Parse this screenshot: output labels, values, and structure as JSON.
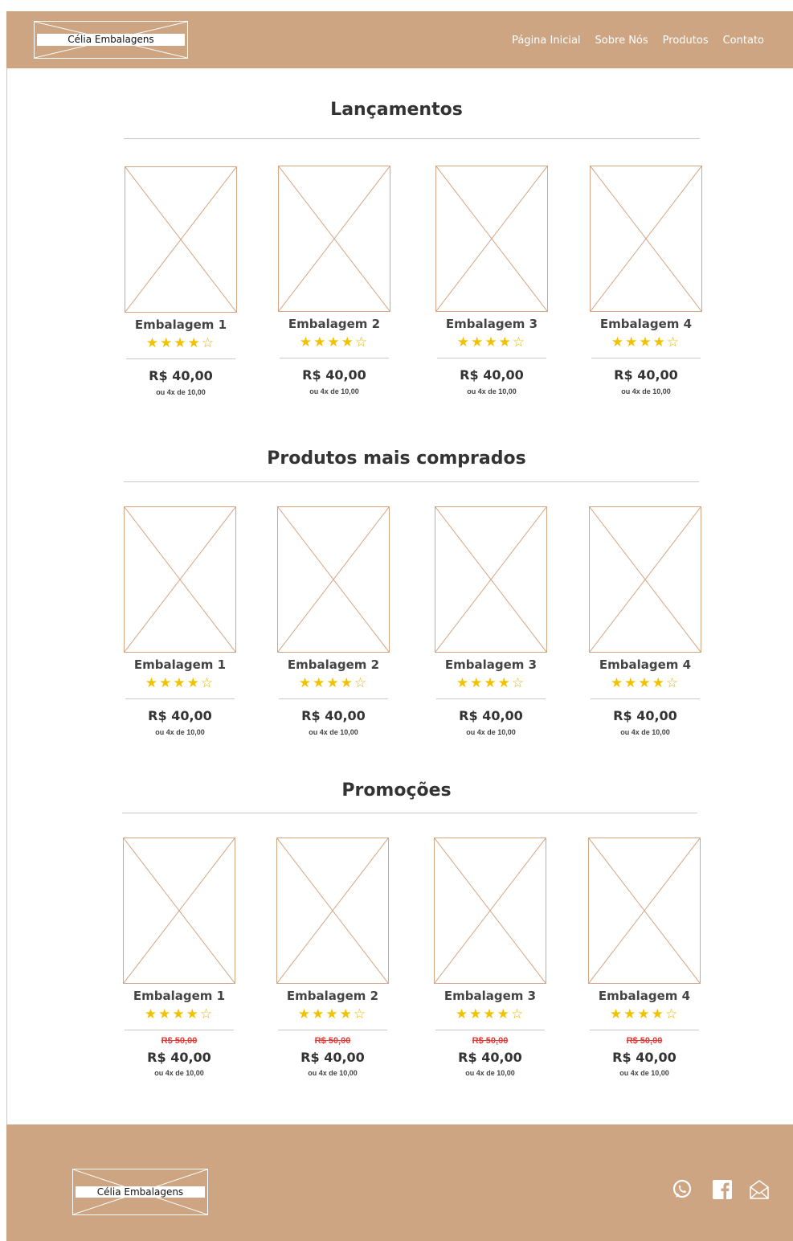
{
  "header": {
    "logo_text": "Célia Embalagens",
    "nav": [
      "Página Inicial",
      "Sobre Nós",
      "Produtos",
      "Contato"
    ]
  },
  "sections": [
    {
      "title": "Lançamentos",
      "products": [
        {
          "name": "Embalagem 1",
          "rating": 4,
          "price": "R$ 40,00",
          "installments": "ou 4x de 10,00"
        },
        {
          "name": "Embalagem 2",
          "rating": 4,
          "price": "R$ 40,00",
          "installments": "ou 4x de 10,00"
        },
        {
          "name": "Embalagem 3",
          "rating": 4,
          "price": "R$ 40,00",
          "installments": "ou 4x de 10,00"
        },
        {
          "name": "Embalagem 4",
          "rating": 4,
          "price": "R$ 40,00",
          "installments": "ou 4x de 10,00"
        }
      ]
    },
    {
      "title": "Produtos mais comprados",
      "products": [
        {
          "name": "Embalagem 1",
          "rating": 4,
          "price": "R$ 40,00",
          "installments": "ou 4x de 10,00"
        },
        {
          "name": "Embalagem 2",
          "rating": 4,
          "price": "R$ 40,00",
          "installments": "ou 4x de 10,00"
        },
        {
          "name": "Embalagem 3",
          "rating": 4,
          "price": "R$ 40,00",
          "installments": "ou 4x de 10,00"
        },
        {
          "name": "Embalagem 4",
          "rating": 4,
          "price": "R$ 40,00",
          "installments": "ou 4x de 10,00"
        }
      ]
    },
    {
      "title": "Promoções",
      "products": [
        {
          "name": "Embalagem 1",
          "rating": 4,
          "old_price": "R$ 50,00",
          "price": "R$ 40,00",
          "installments": "ou 4x de 10,00"
        },
        {
          "name": "Embalagem 2",
          "rating": 4,
          "old_price": "R$ 50,00",
          "price": "R$ 40,00",
          "installments": "ou 4x de 10,00"
        },
        {
          "name": "Embalagem 3",
          "rating": 4,
          "old_price": "R$ 50,00",
          "price": "R$ 40,00",
          "installments": "ou 4x de 10,00"
        },
        {
          "name": "Embalagem 4",
          "rating": 4,
          "old_price": "R$ 50,00",
          "price": "R$ 40,00",
          "installments": "ou 4x de 10,00"
        }
      ]
    }
  ],
  "footer": {
    "logo_text": "Célia Embalagens",
    "social_icons": [
      "whatsapp-icon",
      "facebook-icon",
      "email-icon"
    ]
  },
  "colors": {
    "brand": "#cda582",
    "placeholder_stroke": "#d4a584",
    "star": "#f2c200",
    "old_price": "#e53935"
  }
}
